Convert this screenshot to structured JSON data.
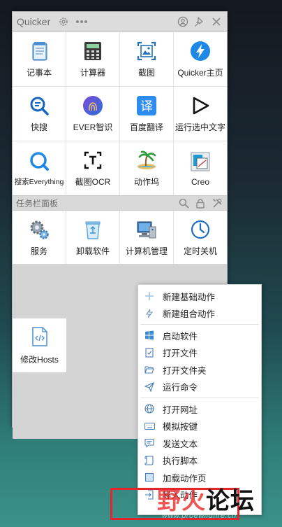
{
  "window": {
    "title": "Quicker"
  },
  "main_actions": [
    {
      "label": "记事本",
      "icon": "notepad-icon"
    },
    {
      "label": "计算器",
      "icon": "calculator-icon"
    },
    {
      "label": "截图",
      "icon": "screenshot-icon"
    },
    {
      "label": "Quicker主页",
      "icon": "quicker-home-icon"
    },
    {
      "label": "快搜",
      "icon": "quick-search-icon"
    },
    {
      "label": "EVER智识",
      "icon": "ever-fingerprint-icon"
    },
    {
      "label": "百度翻译",
      "icon": "translate-icon"
    },
    {
      "label": "运行选中文字",
      "icon": "play-icon"
    },
    {
      "label": "搜索Everything",
      "icon": "everything-search-icon"
    },
    {
      "label": "截图OCR",
      "icon": "ocr-icon"
    },
    {
      "label": "动作坞",
      "icon": "beach-island-icon"
    },
    {
      "label": "Creo",
      "icon": "creo-icon"
    }
  ],
  "taskbar_section": {
    "title": "任务栏面板",
    "items": [
      {
        "label": "服务",
        "icon": "services-gear-icon"
      },
      {
        "label": "卸载软件",
        "icon": "recycle-bin-icon"
      },
      {
        "label": "计算机管理",
        "icon": "computer-management-icon"
      },
      {
        "label": "定时关机",
        "icon": "clock-icon"
      }
    ]
  },
  "extra_action": {
    "label": "修改Hosts",
    "icon": "code-file-icon"
  },
  "context_menu": {
    "group1": [
      {
        "label": "新建基础动作",
        "icon": "plus-icon"
      },
      {
        "label": "新建组合动作",
        "icon": "lightning-icon"
      }
    ],
    "group2": [
      {
        "label": "启动软件",
        "icon": "windows-icon"
      },
      {
        "label": "打开文件",
        "icon": "file-check-icon"
      },
      {
        "label": "打开文件夹",
        "icon": "folder-open-icon"
      },
      {
        "label": "运行命令",
        "icon": "send-icon"
      }
    ],
    "group3": [
      {
        "label": "打开网址",
        "icon": "globe-icon"
      },
      {
        "label": "模拟按键",
        "icon": "keyboard-icon"
      },
      {
        "label": "发送文本",
        "icon": "chat-text-icon"
      },
      {
        "label": "执行脚本",
        "icon": "script-icon"
      },
      {
        "label": "加载动作页",
        "icon": "page-load-icon"
      },
      {
        "label": "导入动作",
        "icon": "import-icon"
      }
    ]
  },
  "watermark": {
    "big_text_a": "野火",
    "big_text_b": "论坛",
    "url": "www.proewildfire.cn"
  },
  "colors": {
    "accent_blue": "#1e88e5",
    "highlight_red": "#e3262b"
  }
}
